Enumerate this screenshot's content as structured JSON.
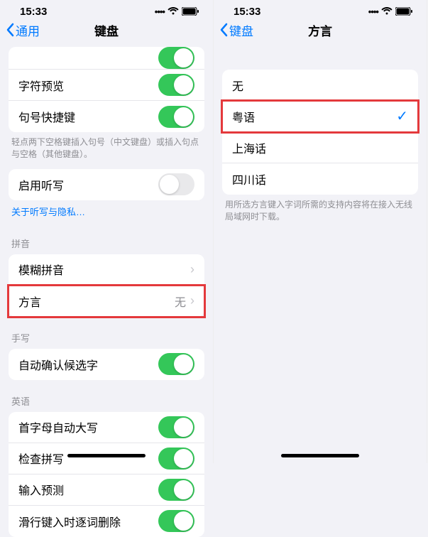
{
  "left": {
    "status": {
      "time": "15:33"
    },
    "nav": {
      "back": "通用",
      "title": "键盘"
    },
    "top_group": {
      "rows": [
        {
          "label": "字符预览",
          "on": true
        },
        {
          "label": "句号快捷键",
          "on": true
        }
      ],
      "footer": "轻点两下空格键插入句号（中文键盘）或插入句点与空格（其他键盘）。"
    },
    "dictation_group": {
      "rows": [
        {
          "label": "启用听写",
          "on": false
        }
      ],
      "footer_link": "关于听写与隐私…"
    },
    "pinyin_group": {
      "header": "拼音",
      "rows": [
        {
          "label": "模糊拼音"
        },
        {
          "label": "方言",
          "value": "无"
        }
      ]
    },
    "handwriting_group": {
      "header": "手写",
      "rows": [
        {
          "label": "自动确认候选字",
          "on": true
        }
      ]
    },
    "english_group": {
      "header": "英语",
      "rows": [
        {
          "label": "首字母自动大写",
          "on": true
        },
        {
          "label": "检查拼写",
          "on": true
        },
        {
          "label": "输入预测",
          "on": true
        },
        {
          "label": "滑行键入时逐词删除",
          "on": true
        }
      ]
    }
  },
  "right": {
    "status": {
      "time": "15:33"
    },
    "nav": {
      "back": "键盘",
      "title": "方言"
    },
    "options": [
      {
        "label": "无",
        "checked": false
      },
      {
        "label": "粤语",
        "checked": true
      },
      {
        "label": "上海话",
        "checked": false
      },
      {
        "label": "四川话",
        "checked": false
      }
    ],
    "footer": "用所选方言键入字词所需的支持内容将在接入无线局域网时下载。"
  }
}
